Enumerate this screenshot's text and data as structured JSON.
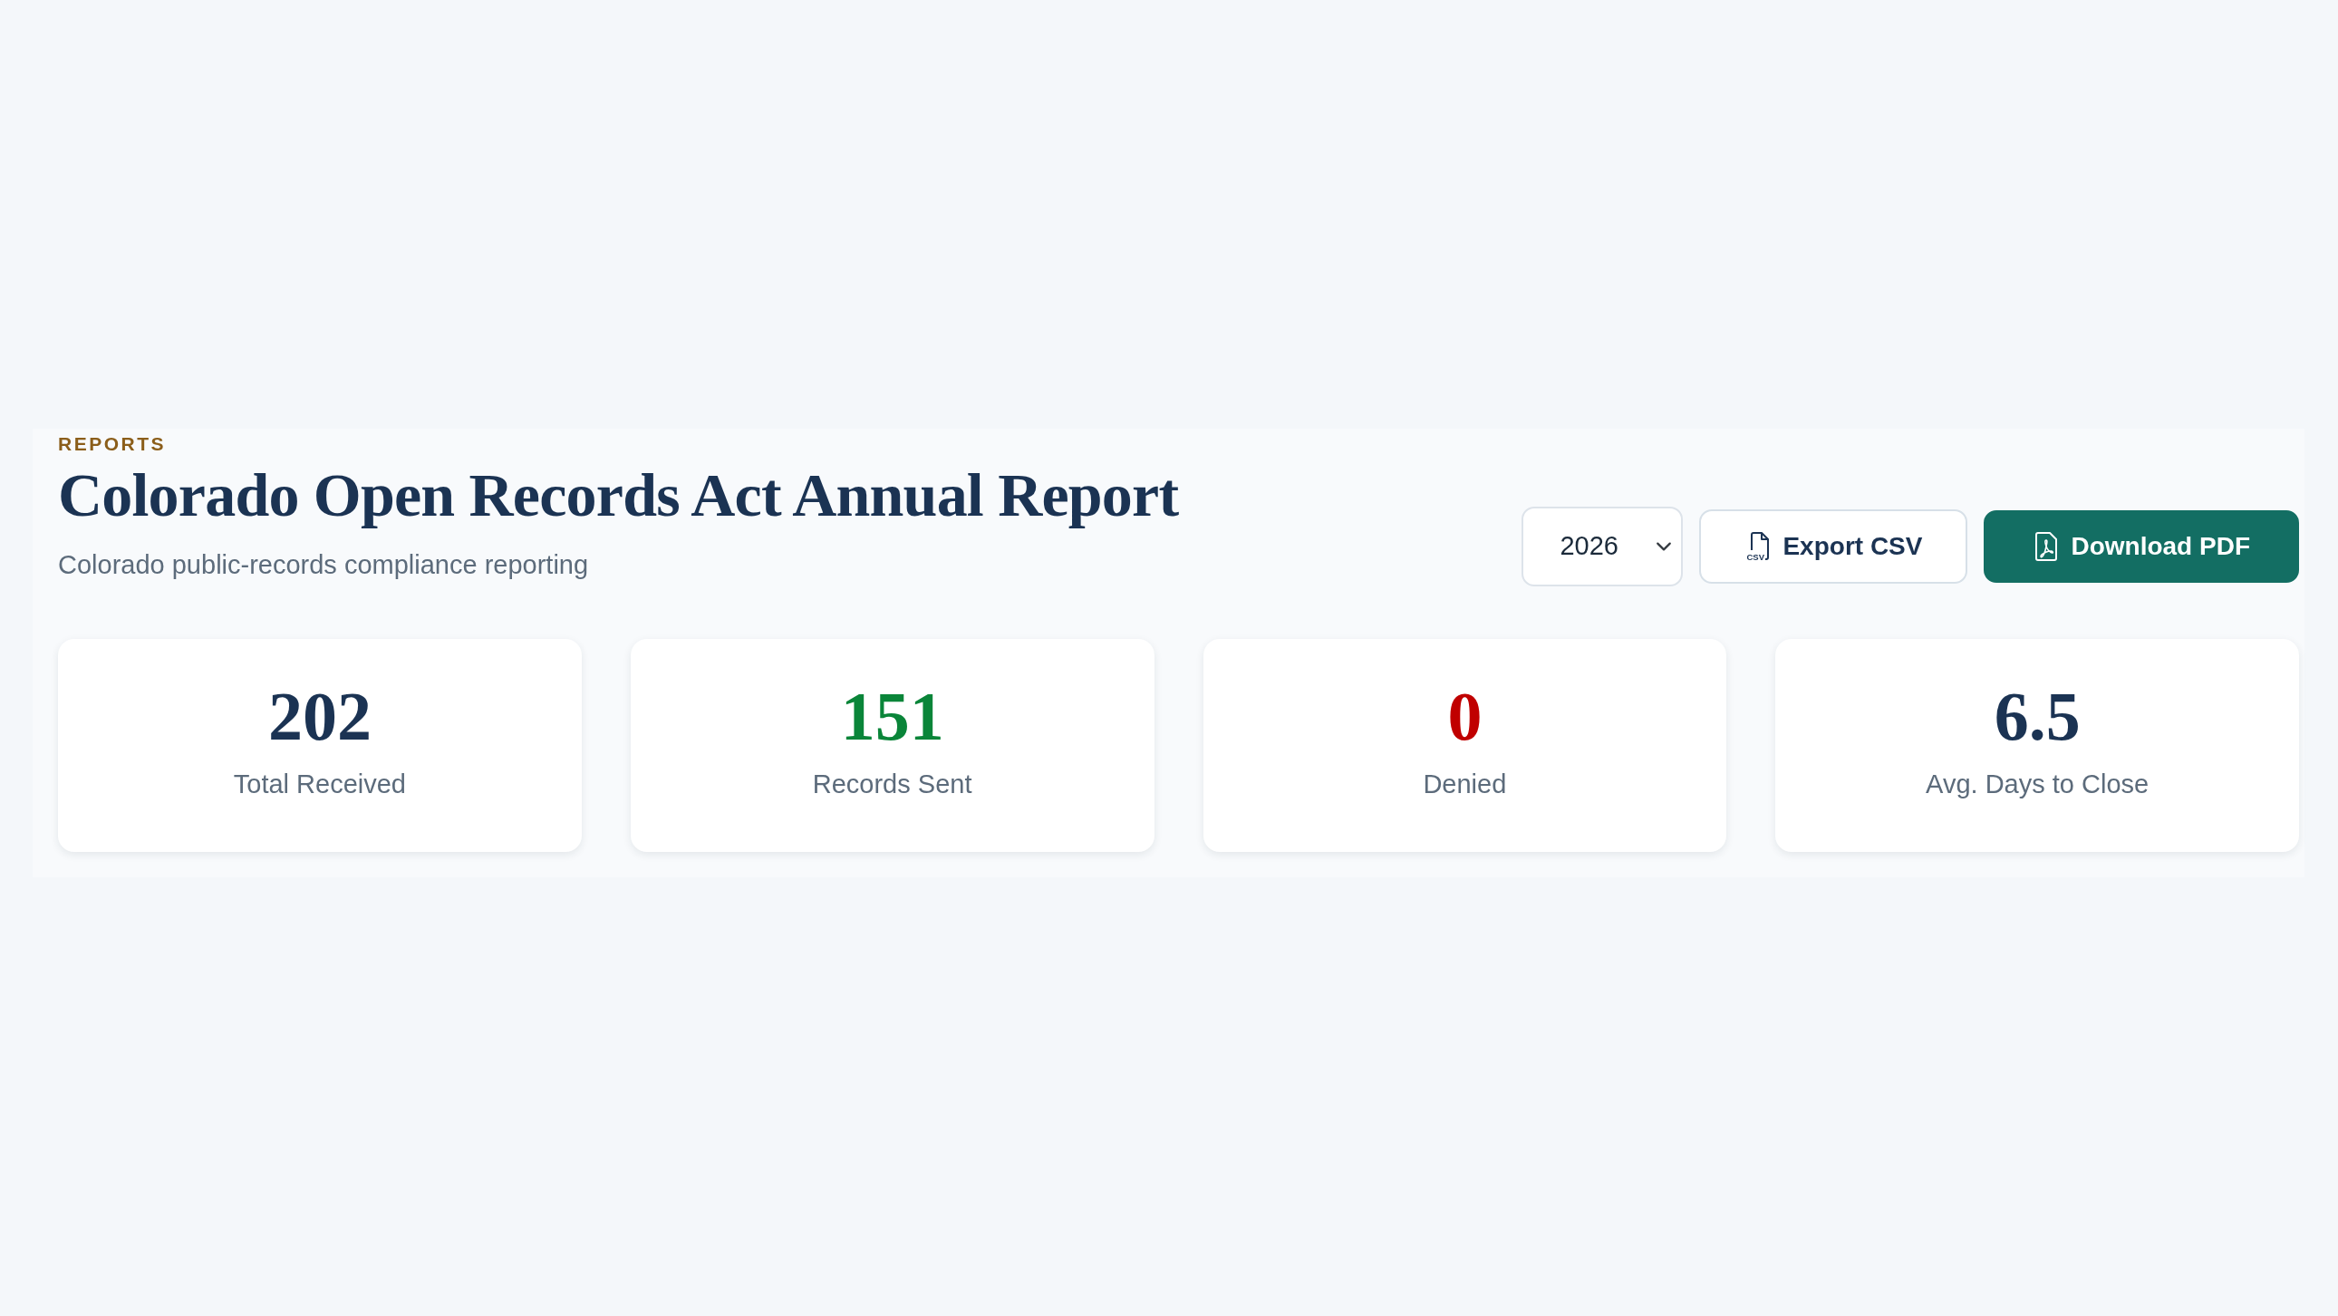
{
  "header": {
    "eyebrow": "REPORTS",
    "title": "Colorado Open Records Act Annual Report",
    "subtitle": "Colorado public-records compliance reporting"
  },
  "toolbar": {
    "year_select": {
      "value": "2026"
    },
    "buttons": [
      {
        "label": "Export CSV",
        "kind": "outline",
        "icon_label": "CSV"
      },
      {
        "label": "Download PDF",
        "kind": "primary"
      }
    ]
  },
  "stats": [
    {
      "value": "202",
      "label": "Total Received",
      "color": "#1b3353"
    },
    {
      "value": "151",
      "label": "Records Sent",
      "color": "#0a8539"
    },
    {
      "value": "0",
      "label": "Denied",
      "color": "#c00000"
    },
    {
      "value": "6.5",
      "label": "Avg. Days to Close",
      "color": "#1b3353"
    }
  ]
}
